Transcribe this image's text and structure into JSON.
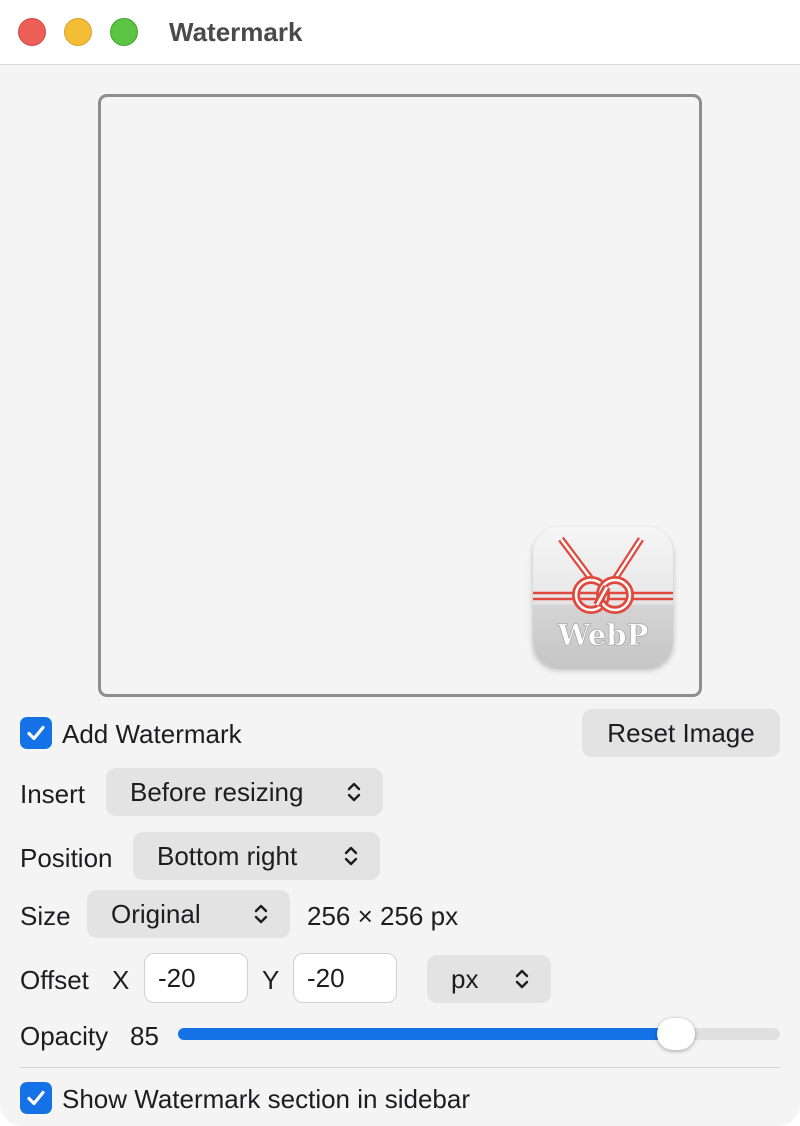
{
  "window": {
    "title": "Watermark"
  },
  "preview": {
    "watermark_icon": "webp-knot-icon",
    "watermark_text": "WebP",
    "colors": {
      "knot": "#e0493e",
      "tile_top": "#f2f2f2",
      "tile_bottom": "#cfcfcf"
    }
  },
  "add_watermark": {
    "label": "Add Watermark",
    "checked": true
  },
  "reset_button": {
    "label": "Reset Image"
  },
  "insert": {
    "label": "Insert",
    "value": "Before resizing"
  },
  "position": {
    "label": "Position",
    "value": "Bottom right"
  },
  "size": {
    "label": "Size",
    "value": "Original",
    "dimensions": "256 × 256 px"
  },
  "offset": {
    "label": "Offset",
    "x_label": "X",
    "x_value": "-20",
    "y_label": "Y",
    "y_value": "-20",
    "unit": "px"
  },
  "opacity": {
    "label": "Opacity",
    "value": "85",
    "fraction": 0.85
  },
  "show_in_sidebar": {
    "label": "Show Watermark section in sidebar",
    "checked": true
  },
  "colors": {
    "accent": "#1472e6"
  }
}
